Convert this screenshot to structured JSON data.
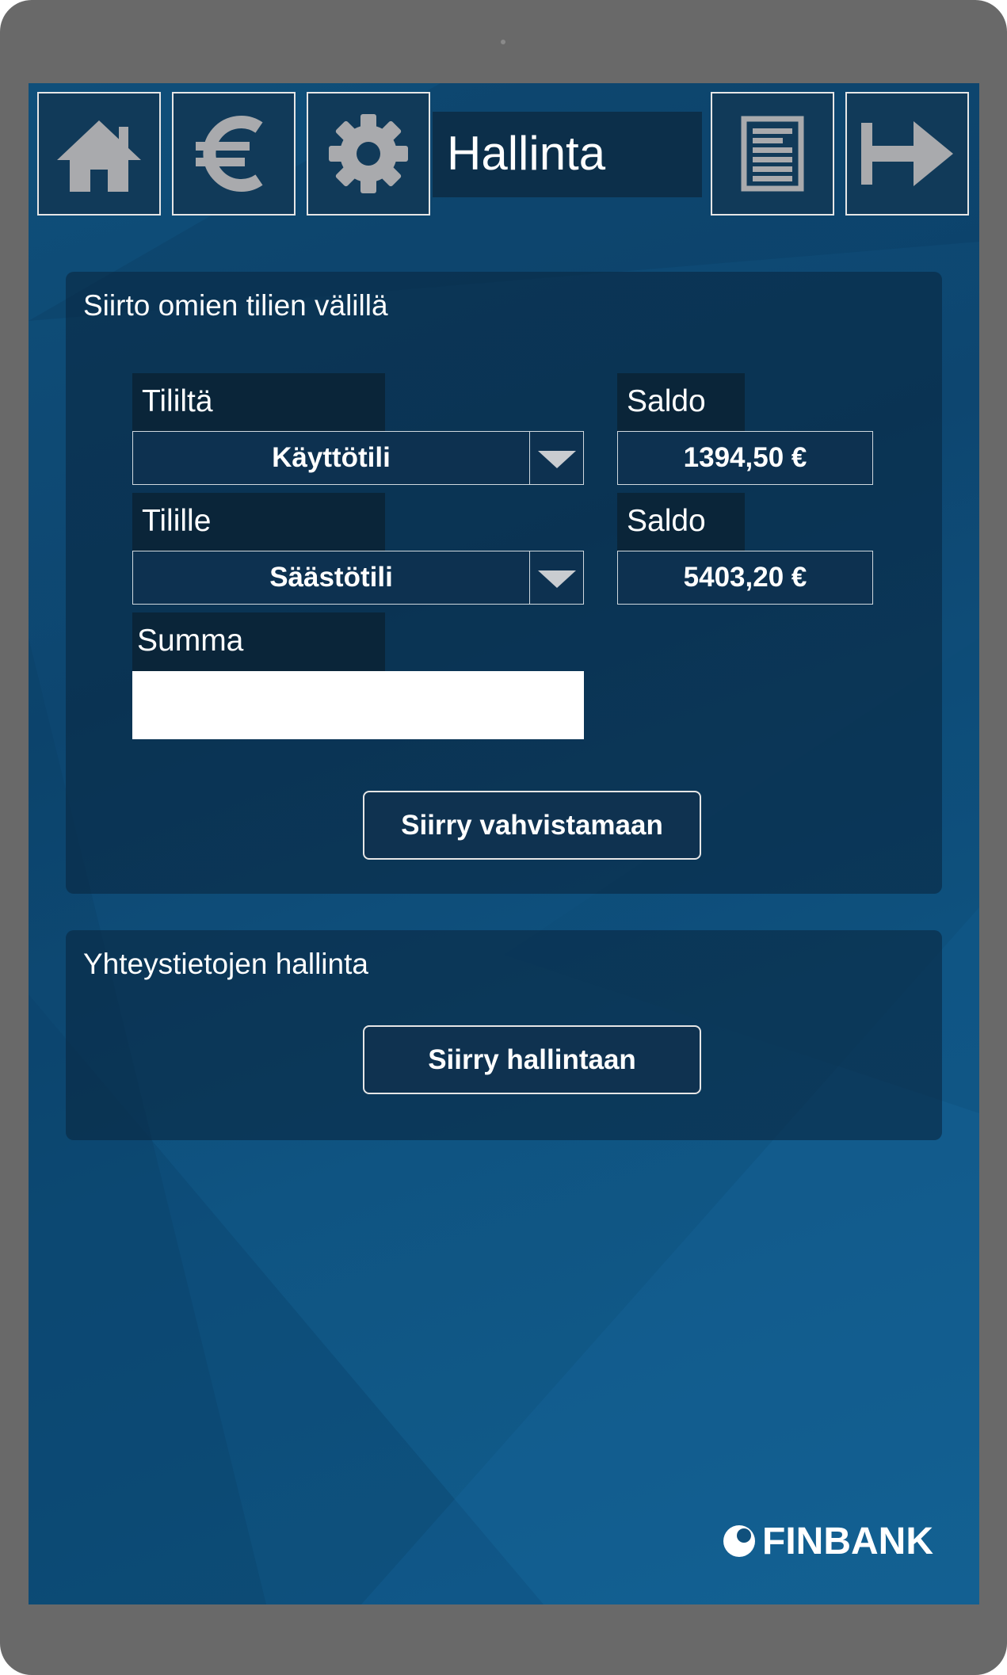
{
  "header": {
    "title": "Hallinta",
    "icons": [
      "home-icon",
      "euro-icon",
      "gear-icon",
      "document-icon",
      "logout-arrow-icon"
    ]
  },
  "transfer": {
    "title": "Siirto omien tilien välillä",
    "from_label": "Tililtä",
    "from_value": "Käyttötili",
    "from_balance_label": "Saldo",
    "from_balance": "1394,50 €",
    "to_label": "Tilille",
    "to_value": "Säästötili",
    "to_balance_label": "Saldo",
    "to_balance": "5403,20 €",
    "amount_label": "Summa",
    "amount_value": "",
    "submit_label": "Siirry vahvistamaan"
  },
  "contacts": {
    "title": "Yhteystietojen hallinta",
    "button_label": "Siirry hallintaan"
  },
  "brand": {
    "name": "FINBANK"
  },
  "colors": {
    "background": "#0f4f7a",
    "panel": "#0a2842",
    "device_frame": "#696969",
    "icon_gray": "#a9aaad"
  }
}
